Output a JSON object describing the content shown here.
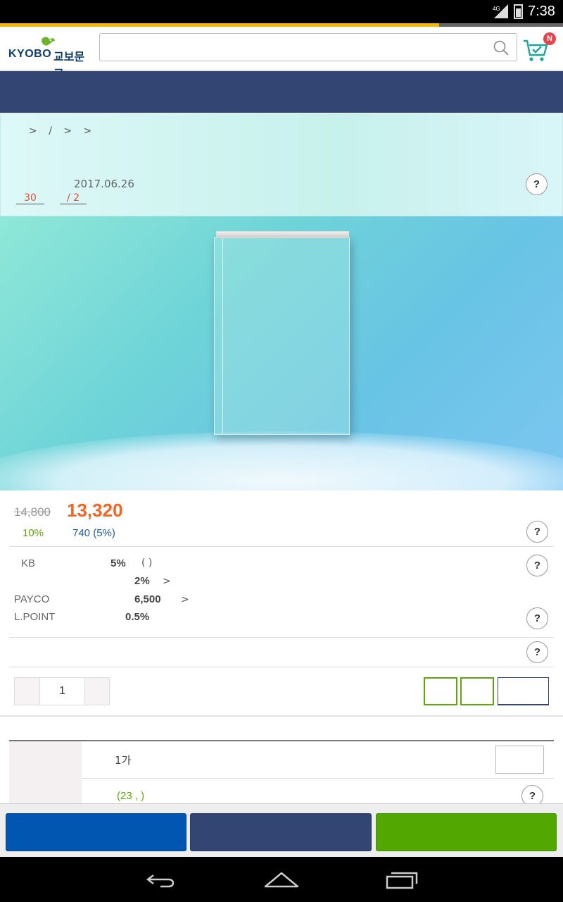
{
  "status_bar": {
    "network": "4G",
    "time": "7:38"
  },
  "page_load_progress": 0.78,
  "header": {
    "logo_text": "KYOBO",
    "logo_text_kr": "교보문고",
    "search_placeholder": "",
    "cart_badge": "N"
  },
  "breadcrumb": [
    ">",
    "/",
    ">",
    ">"
  ],
  "product": {
    "publish_date": "2017.06.26",
    "review_count": "30",
    "rating": "/  2",
    "help": "?"
  },
  "price": {
    "original": "14,800",
    "sale": "13,320",
    "discount": "10%",
    "points": "740  (5%)"
  },
  "benefits": [
    {
      "label": "KB",
      "value": "5%",
      "extra": "(    )"
    },
    {
      "label": "",
      "value": "2%",
      "extra": ">"
    },
    {
      "label": "PAYCO",
      "value": "6,500",
      "extra": ">"
    },
    {
      "label": "L.POINT",
      "value": "0.5%",
      "extra": ""
    }
  ],
  "quantity": {
    "value": "1"
  },
  "options": {
    "row1_text": "1가",
    "review_info": "(23 ,  )"
  },
  "colors": {
    "accent_orange": "#f26522",
    "navy": "#324573",
    "green": "#5ea60c",
    "blue": "#0056b0",
    "bright_green": "#52a800"
  }
}
